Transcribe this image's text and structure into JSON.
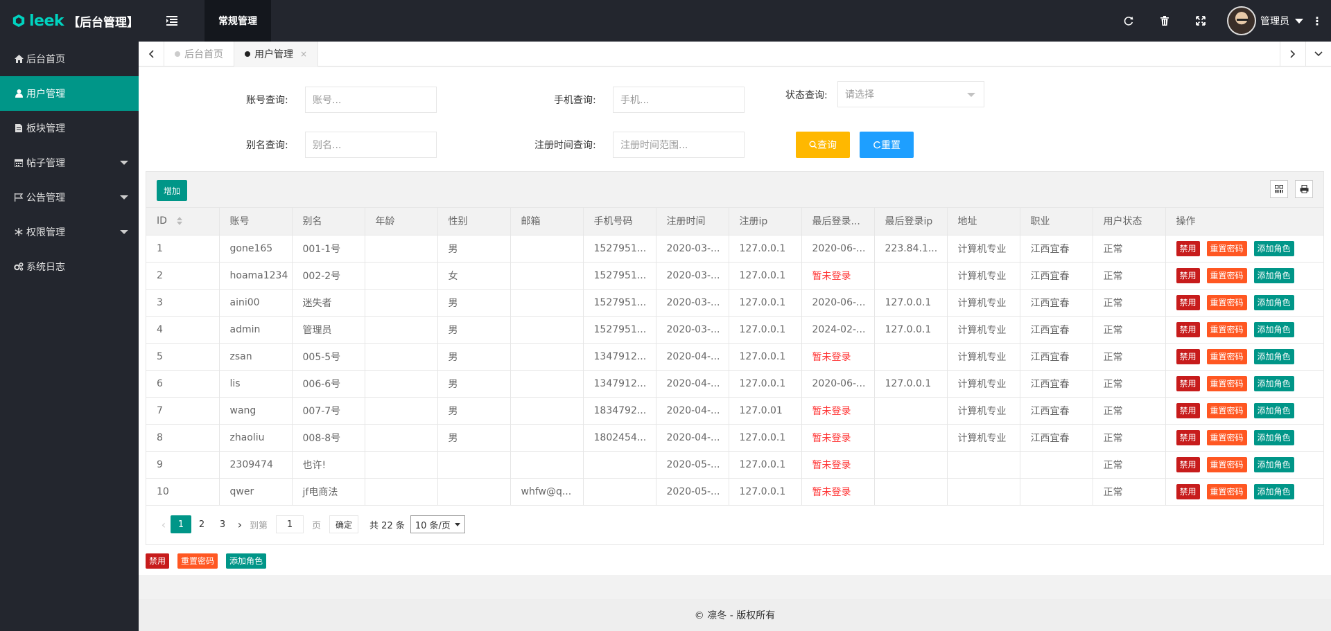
{
  "header": {
    "brand": "leek",
    "title": "【后台管理】",
    "nav_active": "常规管理",
    "user_name": "管理员",
    "more": "⋮",
    "icons": [
      "refresh-icon",
      "trash-icon",
      "fullscreen-icon"
    ]
  },
  "sidebar": {
    "items": [
      {
        "label": "后台首页",
        "icon": "home-icon"
      },
      {
        "label": "用户管理",
        "icon": "user-icon"
      },
      {
        "label": "板块管理",
        "icon": "file-icon"
      },
      {
        "label": "帖子管理",
        "icon": "calendar-icon"
      },
      {
        "label": "公告管理",
        "icon": "flag-icon"
      },
      {
        "label": "权限管理",
        "icon": "snowflake-icon"
      },
      {
        "label": "系统日志",
        "icon": "gears-icon"
      }
    ]
  },
  "tabs": {
    "home": "后台首页",
    "current": "用户管理",
    "close": "×"
  },
  "search": {
    "account_label": "账号查询:",
    "account_placeholder": "账号...",
    "phone_label": "手机查询:",
    "phone_placeholder": "手机...",
    "status_label": "状态查询:",
    "status_placeholder": "请选择",
    "alias_label": "别名查询:",
    "alias_placeholder": "别名...",
    "regtime_label": "注册时间查询:",
    "regtime_placeholder": "注册时间范围...",
    "query_button": "查询",
    "reset_button": "重置"
  },
  "toolbar": {
    "add_button": "增加"
  },
  "table": {
    "columns": [
      "ID",
      "账号",
      "别名",
      "年龄",
      "性别",
      "邮箱",
      "手机号码",
      "注册时间",
      "注册ip",
      "最后登录...",
      "最后登录ip",
      "地址",
      "职业",
      "用户状态",
      "操作"
    ],
    "rows": [
      [
        "1",
        "gone165",
        "001-1号",
        "",
        "男",
        "",
        "1527951...",
        "2020-03-...",
        "127.0.0.1",
        "2020-06-...",
        "223.84.1...",
        "计算机专业",
        "江西宜春",
        "正常"
      ],
      [
        "2",
        "hoama1234",
        "002-2号",
        "",
        "女",
        "",
        "1527951...",
        "2020-03-...",
        "127.0.0.1",
        "暂未登录",
        "",
        "计算机专业",
        "江西宜春",
        "正常"
      ],
      [
        "3",
        "aini00",
        "迷失者",
        "",
        "男",
        "",
        "1527951...",
        "2020-03-...",
        "127.0.0.1",
        "2020-06-...",
        "127.0.0.1",
        "计算机专业",
        "江西宜春",
        "正常"
      ],
      [
        "4",
        "admin",
        "管理员",
        "",
        "男",
        "",
        "1527951...",
        "2020-03-...",
        "127.0.0.1",
        "2024-02-...",
        "127.0.0.1",
        "计算机专业",
        "江西宜春",
        "正常"
      ],
      [
        "5",
        "zsan",
        "005-5号",
        "",
        "男",
        "",
        "1347912...",
        "2020-04-...",
        "127.0.0.1",
        "暂未登录",
        "",
        "计算机专业",
        "江西宜春",
        "正常"
      ],
      [
        "6",
        "lis",
        "006-6号",
        "",
        "男",
        "",
        "1347912...",
        "2020-04-...",
        "127.0.0.1",
        "2020-06-...",
        "127.0.0.1",
        "计算机专业",
        "江西宜春",
        "正常"
      ],
      [
        "7",
        "wang",
        "007-7号",
        "",
        "男",
        "",
        "1834792...",
        "2020-04-...",
        "127.0.01",
        "暂未登录",
        "",
        "计算机专业",
        "江西宜春",
        "正常"
      ],
      [
        "8",
        "zhaoliu",
        "008-8号",
        "",
        "男",
        "",
        "1802454...",
        "2020-04-...",
        "127.0.0.1",
        "暂未登录",
        "",
        "计算机专业",
        "江西宜春",
        "正常"
      ],
      [
        "9",
        "2309474",
        "也许!",
        "",
        "",
        "",
        "",
        "2020-05-...",
        "127.0.0.1",
        "暂未登录",
        "",
        "",
        "",
        "正常"
      ],
      [
        "10",
        "qwer",
        "jf电商法",
        "",
        "",
        "whfw@q...",
        "",
        "2020-05-...",
        "127.0.0.1",
        "暂未登录",
        "",
        "",
        "",
        "正常"
      ]
    ],
    "actions": {
      "ban": "禁用",
      "reset_pwd": "重置密码",
      "add_role": "添加角色"
    }
  },
  "pager": {
    "pages": [
      "1",
      "2",
      "3"
    ],
    "current": "1",
    "goto_label": "到第",
    "goto_value": "1",
    "page_unit": "页",
    "confirm": "确定",
    "total": "共 22 条",
    "page_size": "10 条/页"
  },
  "footer": {
    "copyright": "© 凛冬 - 版权所有"
  },
  "colors": {
    "header_bg": "#23262e",
    "accent": "#009688",
    "query_btn": "#ffb800",
    "reset_btn": "#1e9fff",
    "ban": "#c71c1c",
    "reset_pwd": "#ff5722"
  }
}
